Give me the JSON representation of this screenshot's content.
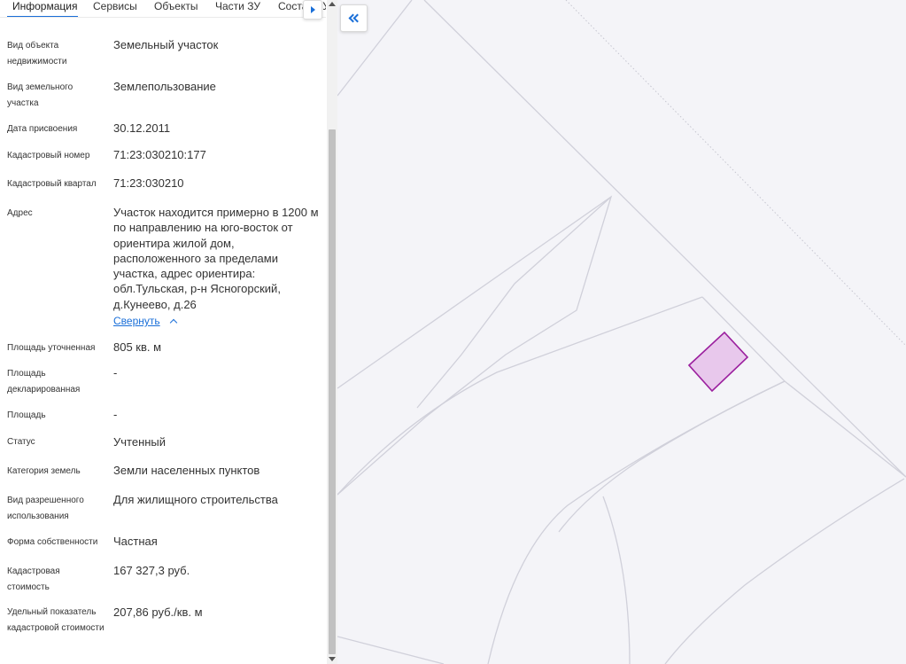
{
  "tabs": [
    {
      "label": "Информация"
    },
    {
      "label": "Сервисы"
    },
    {
      "label": "Объекты"
    },
    {
      "label": "Части ЗУ"
    },
    {
      "label": "Состав ЗУ"
    }
  ],
  "info": {
    "object_type": {
      "label": "Вид объекта недвижимости",
      "value": "Земельный участок"
    },
    "parcel_type": {
      "label": "Вид земельного участка",
      "value": "Землепользование"
    },
    "assign_date": {
      "label": "Дата присвоения",
      "value": "30.12.2011"
    },
    "cadastral_number": {
      "label": "Кадастровый номер",
      "value": "71:23:030210:177"
    },
    "cadastral_quarter": {
      "label": "Кадастровый квартал",
      "value": "71:23:030210"
    },
    "address": {
      "label": "Адрес",
      "value": "Участок находится примерно в 1200 м по направлению на юго-восток от ориентира жилой дом, расположенного за пределами участка, адрес ориентира: обл.Тульская, р-н Ясногорский, д.Кунеево, д.26",
      "collapse": "Свернуть"
    },
    "area_specified": {
      "label": "Площадь уточненная",
      "value": "805 кв. м"
    },
    "area_declared": {
      "label": "Площадь декларированная",
      "value": "-"
    },
    "area": {
      "label": "Площадь",
      "value": "-"
    },
    "status": {
      "label": "Статус",
      "value": "Учтенный"
    },
    "land_category": {
      "label": "Категория земель",
      "value": "Земли населенных пунктов"
    },
    "permitted_use": {
      "label": "Вид разрешенного использования",
      "value": "Для жилищного строительства"
    },
    "ownership": {
      "label": "Форма собственности",
      "value": "Частная"
    },
    "cadastral_value": {
      "label": "Кадастровая стоимость",
      "value": "167 327,3 руб."
    },
    "specific_value": {
      "label": "Удельный показатель кадастровой стоимости",
      "value": "207,86 руб./кв. м"
    }
  },
  "icons": {
    "tab_scroll": "triangle-right-icon",
    "collapse_panel": "double-chevron-left-icon",
    "collapse_address": "chevron-up-icon"
  },
  "colors": {
    "accent": "#1a6fd8",
    "parcel_fill": "#e8c8ec",
    "parcel_stroke": "#9b1f9e",
    "map_background": "#f4f4f8"
  }
}
